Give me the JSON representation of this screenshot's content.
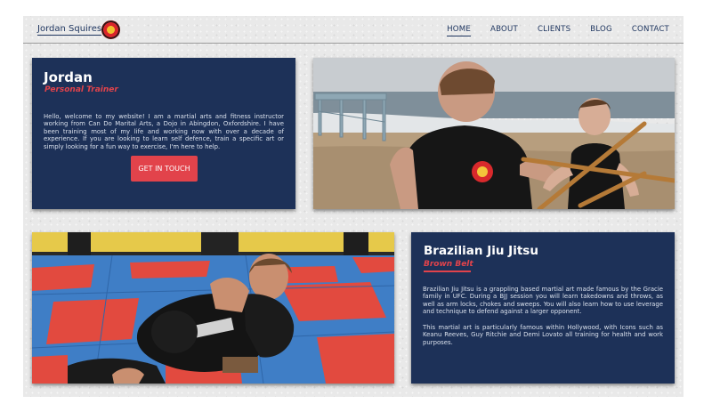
{
  "header": {
    "brand_name": "Jordan Squires",
    "nav": [
      {
        "label": "HOME",
        "active": true
      },
      {
        "label": "ABOUT",
        "active": false
      },
      {
        "label": "CLIENTS",
        "active": false
      },
      {
        "label": "BLOG",
        "active": false
      },
      {
        "label": "CONTACT",
        "active": false
      }
    ]
  },
  "intro": {
    "title": "Jordan",
    "subtitle": "Personal Trainer",
    "body": "Hello, welcome to my website! I am a martial arts and fitness instructor working from Can Do Marital Arts, a Dojo in Abingdon, Oxfordshire. I have been training most of my life and working now with over a decade of experience. If you are looking to learn self defence, train a specific art or simply looking for a fun way to exercise, I'm here to help.",
    "cta_label": "GET IN TOUCH"
  },
  "bjj": {
    "title": "Brazilian Jiu Jitsu",
    "subtitle": "Brown Belt",
    "paragraph1": "Brazilian Jiu Jitsu is a grappling based martial art made famous by the Gracie family in UFC. During a BJJ session you will learn takedowns and throws, as well as arm locks, chokes and sweeps. You will also learn how to use leverage and technique to defend against a larger opponent.",
    "paragraph2": "This martial art is particularly famous within Hollywood, with Icons such as Keanu Reeves, Guy Ritchie and Demi Lovato all training for health and work purposes."
  },
  "colors": {
    "navy": "#1d3158",
    "accent_red": "#e2434b",
    "nav_text": "#1f3660",
    "page_bg": "#e9e9e9"
  },
  "icons": {
    "logo": "martial-arts-emblem-icon"
  }
}
